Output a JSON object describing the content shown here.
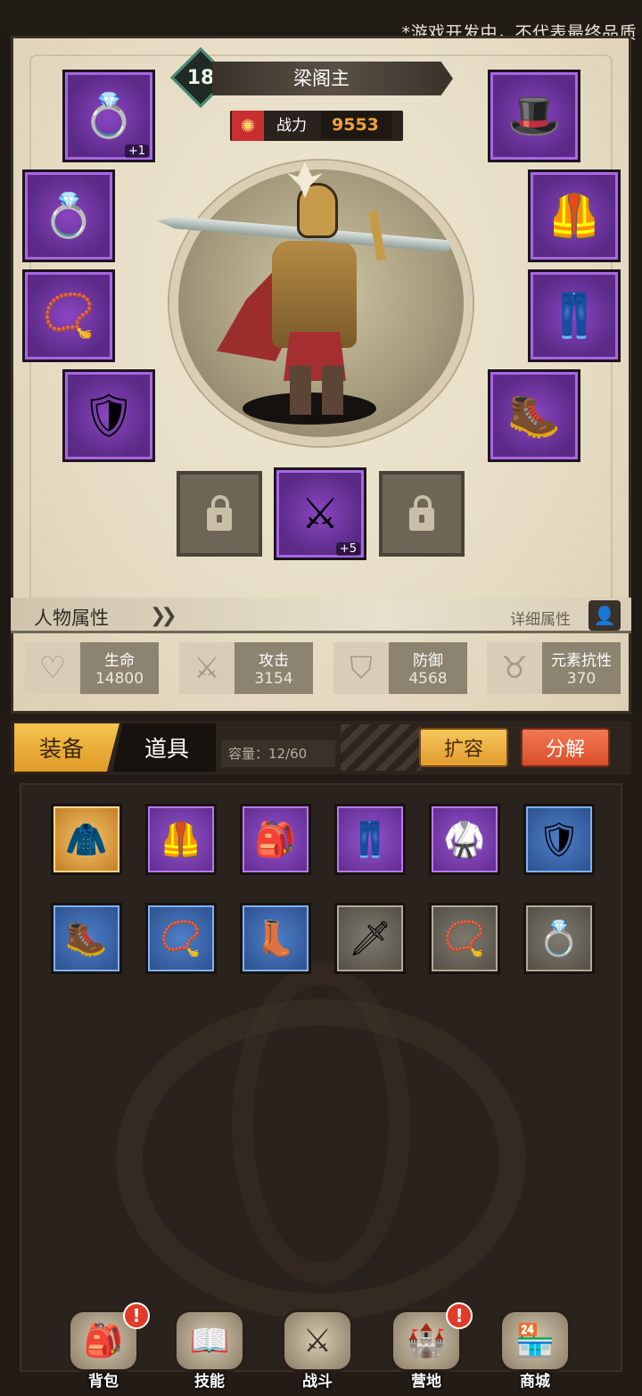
{
  "notice": "*游戏开发中，不代表最终品质",
  "hero": {
    "level": "18",
    "name": "梁阁主",
    "power_label": "战力",
    "power_value": "9553"
  },
  "equipment": {
    "left": [
      {
        "name": "ring-slot-1",
        "icon": "ring-icon",
        "glyph": "💍",
        "plus": "+1"
      },
      {
        "name": "ring-slot-2",
        "icon": "ring-icon",
        "glyph": "💍",
        "plus": ""
      },
      {
        "name": "amulet-slot",
        "icon": "amulet-icon",
        "glyph": "📿",
        "plus": ""
      },
      {
        "name": "shield-slot",
        "icon": "shield-icon",
        "glyph": "🛡",
        "plus": ""
      }
    ],
    "right": [
      {
        "name": "hat-slot",
        "icon": "hat-icon",
        "glyph": "🎩",
        "plus": ""
      },
      {
        "name": "chest-slot",
        "icon": "chest-armor-icon",
        "glyph": "🦺",
        "plus": ""
      },
      {
        "name": "pants-slot",
        "icon": "pants-icon",
        "glyph": "👖",
        "plus": ""
      },
      {
        "name": "boots-slot",
        "icon": "boots-icon",
        "glyph": "🥾",
        "plus": ""
      }
    ],
    "weapon": {
      "icon": "sword-icon",
      "glyph": "⚔",
      "plus": "+5"
    }
  },
  "attributes": {
    "title": "人物属性",
    "detail_label": "详细属性",
    "stats": [
      {
        "label": "生命",
        "value": "14800",
        "icon": "heart-icon",
        "glyph": "♡"
      },
      {
        "label": "攻击",
        "value": "3154",
        "icon": "attack-icon",
        "glyph": "⚔"
      },
      {
        "label": "防御",
        "value": "4568",
        "icon": "defense-icon",
        "glyph": "⛉"
      },
      {
        "label": "元素抗性",
        "value": "370",
        "icon": "element-icon",
        "glyph": "♉"
      }
    ]
  },
  "inventory": {
    "tabs": [
      "装备",
      "道具"
    ],
    "capacity": "容量：12/60",
    "expand_label": "扩容",
    "decompose_label": "分解",
    "items": [
      {
        "icon": "cloak-icon",
        "glyph": "🧥",
        "quality": "orange"
      },
      {
        "icon": "chest-armor-icon",
        "glyph": "🦺",
        "quality": "purple"
      },
      {
        "icon": "belt-icon",
        "glyph": "🎒",
        "quality": "purple"
      },
      {
        "icon": "pants-icon",
        "glyph": "👖",
        "quality": "purple"
      },
      {
        "icon": "vest-icon",
        "glyph": "🥋",
        "quality": "purple"
      },
      {
        "icon": "shield-icon",
        "glyph": "🛡",
        "quality": "blue"
      },
      {
        "icon": "boots-icon",
        "glyph": "🥾",
        "quality": "blue"
      },
      {
        "icon": "amulet-icon",
        "glyph": "📿",
        "quality": "blue"
      },
      {
        "icon": "boots-icon",
        "glyph": "👢",
        "quality": "blue"
      },
      {
        "icon": "dagger-icon",
        "glyph": "🗡",
        "quality": "gray"
      },
      {
        "icon": "amulet-icon",
        "glyph": "📿",
        "quality": "gray"
      },
      {
        "icon": "ring-icon",
        "glyph": "💍",
        "quality": "gray"
      }
    ]
  },
  "nav": [
    {
      "label": "背包",
      "icon": "backpack-icon",
      "glyph": "🎒",
      "badge": "!"
    },
    {
      "label": "技能",
      "icon": "skill-book-icon",
      "glyph": "📖",
      "badge": ""
    },
    {
      "label": "战斗",
      "icon": "battle-icon",
      "glyph": "⚔",
      "badge": ""
    },
    {
      "label": "营地",
      "icon": "camp-castle-icon",
      "glyph": "🏰",
      "badge": "!"
    },
    {
      "label": "商城",
      "icon": "shop-icon",
      "glyph": "🏪",
      "badge": ""
    }
  ],
  "colors": {
    "gold": "#f3c84a",
    "purple": "#8a46c2",
    "blue": "#4d7fc8",
    "orange": "#e29b2e",
    "red": "#e23a2a"
  }
}
